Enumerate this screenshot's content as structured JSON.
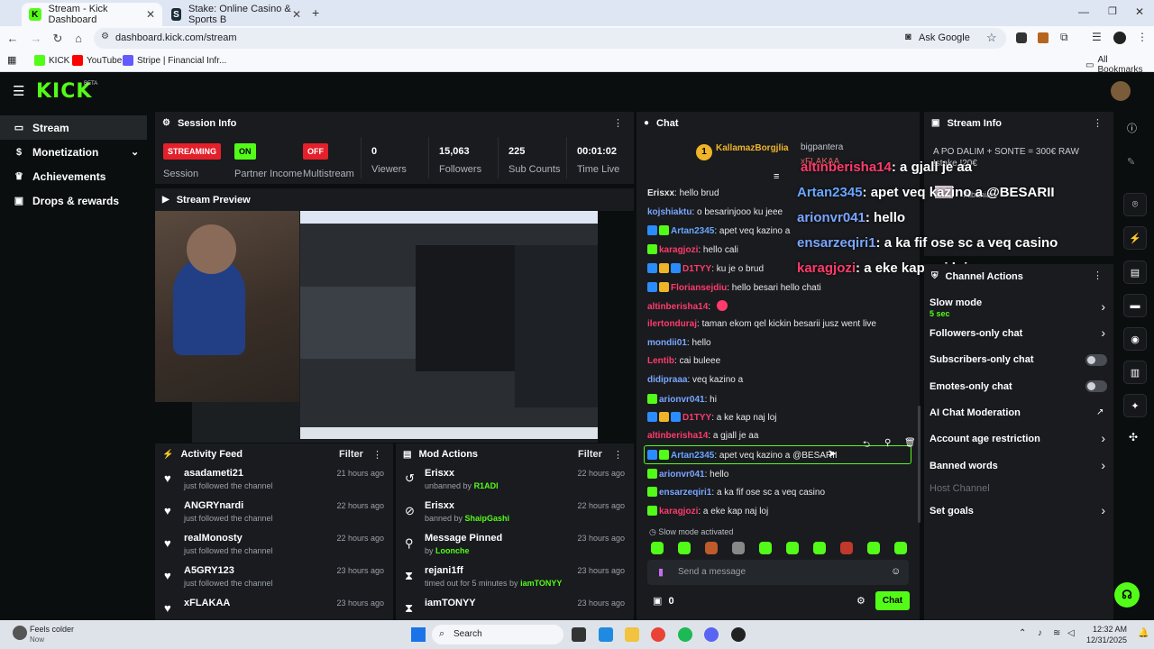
{
  "browser": {
    "tabs": [
      {
        "title": "Stream - Kick Dashboard"
      },
      {
        "title": "Stake: Online Casino & Sports B"
      }
    ],
    "url": "dashboard.kick.com/stream",
    "ask_google": "Ask Google",
    "bookmarks": [
      "KICK",
      "YouTube",
      "Stripe | Financial Infr..."
    ],
    "all_bookmarks": "All Bookmarks"
  },
  "kick": {
    "logo": "KICK",
    "beta": "BETA",
    "sidebar": [
      {
        "label": "Stream",
        "icon": "stream-icon"
      },
      {
        "label": "Monetization",
        "icon": "dollar-icon"
      },
      {
        "label": "Achievements",
        "icon": "trophy-icon"
      },
      {
        "label": "Drops & rewards",
        "icon": "gift-icon"
      }
    ],
    "session": {
      "title": "Session Info",
      "streaming_badge": "STREAMING",
      "session_label": "Session",
      "partner_badge": "ON",
      "partner_label": "Partner Income",
      "multistream_badge": "OFF",
      "multistream_label": "Multistream",
      "viewers": "0",
      "viewers_label": "Viewers",
      "followers": "15,063",
      "followers_label": "Followers",
      "subs": "225",
      "subs_label": "Sub Counts",
      "time": "00:01:02",
      "time_label": "Time Live"
    },
    "preview_title": "Stream Preview",
    "activity": {
      "title": "Activity Feed",
      "filter": "Filter",
      "items": [
        {
          "name": "asadameti21",
          "sub": "just followed the channel",
          "time": "21 hours ago"
        },
        {
          "name": "ANGRYnardi",
          "sub": "just followed the channel",
          "time": "22 hours ago"
        },
        {
          "name": "realMonosty",
          "sub": "just followed the channel",
          "time": "22 hours ago"
        },
        {
          "name": "A5GRY123",
          "sub": "just followed the channel",
          "time": "23 hours ago"
        },
        {
          "name": "xFLAKAA",
          "sub": "",
          "time": "23 hours ago"
        }
      ]
    },
    "mod": {
      "title": "Mod Actions",
      "filter": "Filter",
      "items": [
        {
          "name": "Erisxx",
          "pre": "unbanned by ",
          "by": "R1ADI",
          "time": "22 hours ago",
          "icon": "undo-icon"
        },
        {
          "name": "Erisxx",
          "pre": "banned by ",
          "by": "ShaipGashi",
          "time": "22 hours ago",
          "icon": "ban-icon"
        },
        {
          "name": "Message Pinned",
          "pre": "by ",
          "by": "Loonche",
          "time": "23 hours ago",
          "icon": "pin-icon"
        },
        {
          "name": "rejani1ff",
          "pre": "timed out for 5 minutes by ",
          "by": "iamTONYY",
          "time": "23 hours ago",
          "icon": "hourglass-icon"
        },
        {
          "name": "iamTONYY",
          "pre": "",
          "by": "",
          "time": "23 hours ago",
          "icon": "hourglass-icon"
        }
      ]
    },
    "chat": {
      "title": "Chat",
      "pinned_user": "KallamazBorgjlia",
      "pinned_count": "1",
      "messages": [
        {
          "user": "Erisxx",
          "color": "#e8e8e8",
          "text": "hello brud"
        },
        {
          "user": "kojshiaktu",
          "color": "#7aa6ff",
          "text": "o besarinjooo ku jeee"
        },
        {
          "user": "Artan2345",
          "color": "#6aa6ff",
          "text": "apet veq kazino a"
        },
        {
          "user": "karagjozi",
          "color": "#ff3b6b",
          "text": "hello cali"
        },
        {
          "user": "D1TYY",
          "color": "#ff3b6b",
          "text": "ku je o brud"
        },
        {
          "user": "Floriansejdiu",
          "color": "#ff3b6b",
          "text": "hello besari hello chati"
        },
        {
          "user": "altinberisha14",
          "color": "#ff3b6b",
          "text": ""
        },
        {
          "user": "ilertonduraj",
          "color": "#ff3b6b",
          "text": "taman ekom qel kickin besarii jusz went live"
        },
        {
          "user": "mondii01",
          "color": "#7aa6ff",
          "text": "hello"
        },
        {
          "user": "Lentib",
          "color": "#ff3b6b",
          "text": "cai buleee"
        },
        {
          "user": "didipraaa",
          "color": "#7aa6ff",
          "text": "veq kazino a"
        },
        {
          "user": "arionvr041",
          "color": "#7aa6ff",
          "text": "hi"
        },
        {
          "user": "D1TYY",
          "color": "#ff3b6b",
          "text": "a ke kap naj loj"
        },
        {
          "user": "altinberisha14",
          "color": "#ff3b6b",
          "text": "a gjall je aa"
        },
        {
          "user": "Artan2345",
          "color": "#6aa6ff",
          "text": "apet veq kazino a @BESARII"
        },
        {
          "user": "arionvr041",
          "color": "#7aa6ff",
          "text": "hello"
        },
        {
          "user": "ensarzeqiri1",
          "color": "#7aa6ff",
          "text": "a ka fif ose sc a veq casino"
        },
        {
          "user": "karagjozi",
          "color": "#ff3b6b",
          "text": "a eke kap naj loj"
        }
      ],
      "slow_mode": "Slow mode activated",
      "placeholder": "Send a message",
      "count": "0",
      "chat_button": "Chat"
    },
    "overlay": [
      {
        "user": "altinberisha14",
        "text": ": a gjall je aa",
        "color": "#ff3b6b"
      },
      {
        "user": "Artan2345",
        "text": ": apet veq kazino a @BESARII",
        "color": "#6aa6ff"
      },
      {
        "user": "arionvr041",
        "text": ": hello",
        "color": "#7aa6ff"
      },
      {
        "user": "ensarzeqiri1",
        "text": ": a ka fif ose sc a veq casino",
        "color": "#7aa6ff"
      },
      {
        "user": "karagjozi",
        "text": ": a eke kap naj loj",
        "color": "#ff3b6b"
      }
    ],
    "stream_info": {
      "title": "Stream Info",
      "text": "A PO DALIM + SONTE = 300€ RAW !stake !20€",
      "language": "Albanian",
      "ghost1": "bigpantera",
      "ghost2": "xFLAKAA"
    },
    "channel_actions": {
      "title": "Channel Actions",
      "slow_mode": "Slow mode",
      "slow_value": "5 sec",
      "followers_only": "Followers-only chat",
      "subs_only": "Subscribers-only chat",
      "emotes_only": "Emotes-only chat",
      "ai_mod": "AI Chat Moderation",
      "age": "Account age restriction",
      "banned": "Banned words",
      "host": "Host Channel",
      "goals": "Set goals"
    }
  },
  "taskbar": {
    "weather": "Feels colder",
    "weather_sub": "Now",
    "search": "Search",
    "time": "12:32 AM",
    "date": "12/31/2025"
  }
}
